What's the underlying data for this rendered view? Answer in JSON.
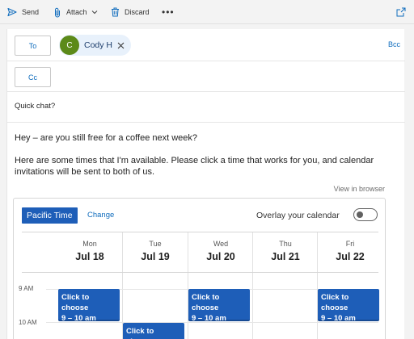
{
  "toolbar": {
    "send_label": "Send",
    "attach_label": "Attach",
    "discard_label": "Discard",
    "more_label": "•••"
  },
  "recipients": {
    "to_label": "To",
    "cc_label": "Cc",
    "bcc_label": "Bcc",
    "to_chip": {
      "initial": "C",
      "name": "Cody H",
      "avatar_color": "#5c8a19"
    }
  },
  "subject": "Quick chat?",
  "body": {
    "line1": "Hey – are you still free for a coffee next week?",
    "line2": "Here are some times that I'm available. Please click a time that works for you, and calendar invitations will be sent to both of us."
  },
  "view_in_browser": "View in browser",
  "scheduler": {
    "timezone_label": "Pacific Time",
    "change_label": "Change",
    "overlay_label": "Overlay your calendar",
    "overlay_enabled": false,
    "accent_color": "#1e5eb8",
    "days": [
      {
        "dow": "Mon",
        "date": "Jul 18"
      },
      {
        "dow": "Tue",
        "date": "Jul 19"
      },
      {
        "dow": "Wed",
        "date": "Jul 20"
      },
      {
        "dow": "Thu",
        "date": "Jul 21"
      },
      {
        "dow": "Fri",
        "date": "Jul 22"
      }
    ],
    "hours": [
      "9 AM",
      "10 AM"
    ],
    "slots": [
      {
        "day": "Mon",
        "title": "Click to choose",
        "time": "9 – 10 am"
      },
      {
        "day": "Wed",
        "title": "Click to choose",
        "time": "9 – 10 am"
      },
      {
        "day": "Fri",
        "title": "Click to choose",
        "time": "9 – 10 am"
      },
      {
        "day": "Tue",
        "title": "Click to choose",
        "time": ""
      }
    ]
  }
}
